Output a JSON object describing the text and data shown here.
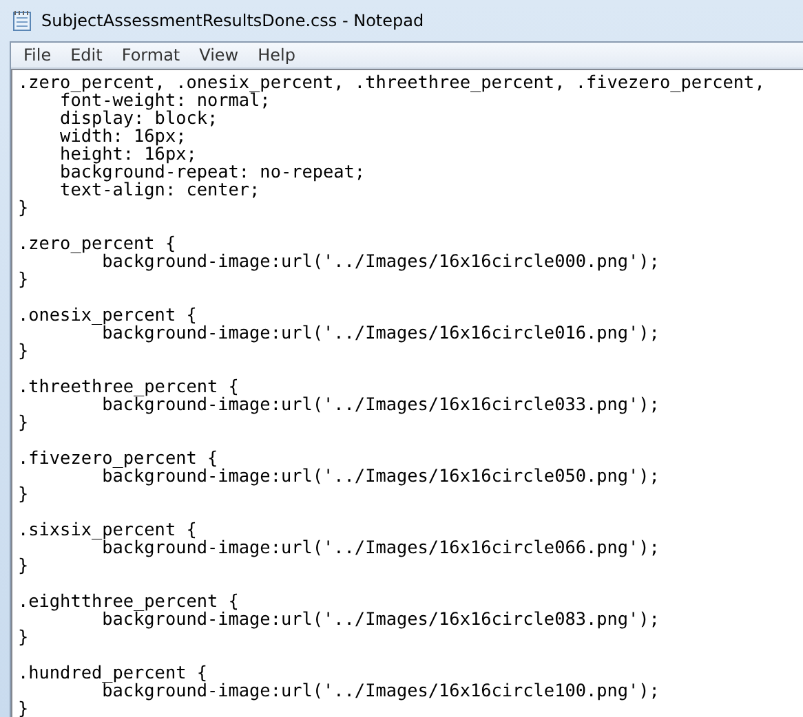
{
  "window": {
    "title": "SubjectAssessmentResultsDone.css - Notepad"
  },
  "menu": [
    "File",
    "Edit",
    "Format",
    "View",
    "Help"
  ],
  "editor": {
    "blocks": [
      [
        ".zero_percent, .onesix_percent, .threethree_percent, .fivezero_percent,",
        "    font-weight: normal;",
        "    display: block;",
        "    width: 16px;",
        "    height: 16px;",
        "    background-repeat: no-repeat;",
        "    text-align: center;",
        "}"
      ],
      [
        ".zero_percent {",
        "\tbackground-image:url('../Images/16x16circle000.png');",
        "}"
      ],
      [
        ".onesix_percent {",
        "\tbackground-image:url('../Images/16x16circle016.png');",
        "}"
      ],
      [
        ".threethree_percent {",
        "\tbackground-image:url('../Images/16x16circle033.png');",
        "}"
      ],
      [
        ".fivezero_percent {",
        "\tbackground-image:url('../Images/16x16circle050.png');",
        "}"
      ],
      [
        ".sixsix_percent {",
        "\tbackground-image:url('../Images/16x16circle066.png');",
        "}"
      ],
      [
        ".eightthree_percent {",
        "\tbackground-image:url('../Images/16x16circle083.png');",
        "}"
      ],
      [
        ".hundred_percent {",
        "\tbackground-image:url('../Images/16x16circle100.png');",
        "}"
      ]
    ]
  }
}
